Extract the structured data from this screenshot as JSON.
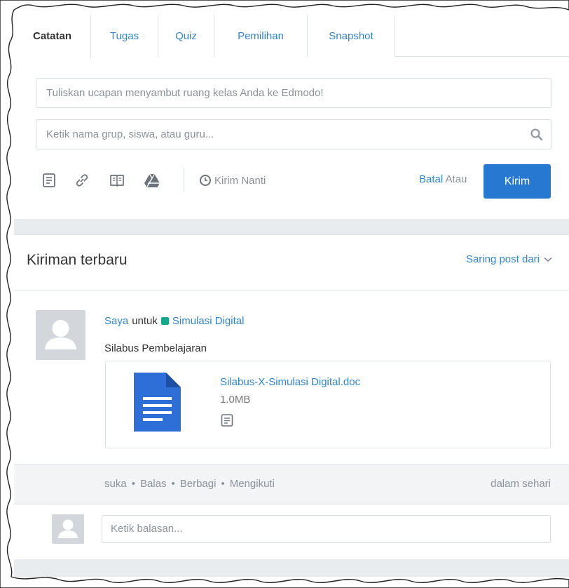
{
  "tabs": [
    {
      "label": "Catatan",
      "active": true
    },
    {
      "label": "Tugas",
      "active": false
    },
    {
      "label": "Quiz",
      "active": false
    },
    {
      "label": "Pemilihan",
      "active": false
    },
    {
      "label": "Snapshot",
      "active": false
    }
  ],
  "composer": {
    "post_placeholder": "Tuliskan ucapan menyambut ruang kelas Anda ke Edmodo!",
    "recipient_placeholder": "Ketik nama grup, siswa, atau guru...",
    "tools": [
      "note-icon",
      "link-icon",
      "library-icon",
      "drive-icon"
    ],
    "schedule_label": "Kirim Nanti",
    "cancel_label": "Batal",
    "or_label": "Atau",
    "send_label": "Kirim"
  },
  "feed": {
    "title": "Kiriman terbaru",
    "filter_label": "Saring post dari",
    "post": {
      "author": "Saya",
      "to_word": "untuk",
      "group": "Simulasi Digital",
      "group_color": "#17a78b",
      "text": "Silabus Pembelajaran",
      "attachment": {
        "name": "Silabus-X-Simulasi Digital.doc",
        "size": "1.0MB"
      },
      "actions": [
        "suka",
        "Balas",
        "Berbagi",
        "Mengikuti"
      ],
      "timestamp": "dalam sehari",
      "reply_placeholder": "Ketik balasan..."
    }
  },
  "colors": {
    "accent": "#2e85d6",
    "button": "#2778d0",
    "doc_icon": "#2d6fd6"
  }
}
